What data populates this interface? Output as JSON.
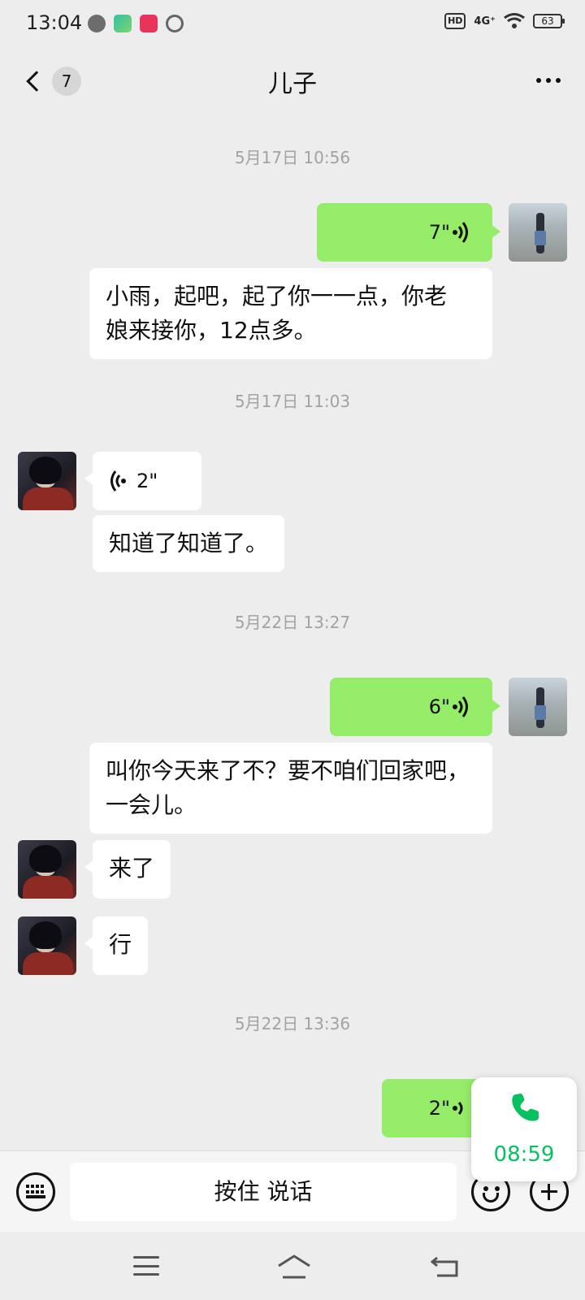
{
  "status_bar": {
    "time": "13:04",
    "network_badge": "HD",
    "signal": "4G⁺",
    "battery": "63"
  },
  "header": {
    "back_icon": "chevron-left-icon",
    "unread_count": "7",
    "title": "儿子",
    "more_icon": "more-dots-icon"
  },
  "messages": [
    {
      "type": "timestamp",
      "text": "5月17日 10:56"
    },
    {
      "type": "voice",
      "from": "me",
      "duration": "7\""
    },
    {
      "type": "transcript",
      "text_line1": "小雨，起吧，起了你一一点，你老",
      "text_line2": "娘来接你，12点多。"
    },
    {
      "type": "timestamp",
      "text": "5月17日 11:03"
    },
    {
      "type": "voice",
      "from": "other",
      "duration": "2\""
    },
    {
      "type": "transcript",
      "text": "知道了知道了。"
    },
    {
      "type": "timestamp",
      "text": "5月22日 13:27"
    },
    {
      "type": "voice",
      "from": "me",
      "duration": "6\""
    },
    {
      "type": "transcript",
      "text_line1": "叫你今天来了不？要不咱们回家吧，",
      "text_line2": "一会儿。"
    },
    {
      "type": "text",
      "from": "other",
      "text": "来了"
    },
    {
      "type": "text",
      "from": "other",
      "text": "行"
    },
    {
      "type": "timestamp",
      "text": "5月22日 13:36"
    },
    {
      "type": "voice",
      "from": "me",
      "duration": "2\""
    }
  ],
  "input_bar": {
    "keyboard_icon": "keyboard-icon",
    "hold_to_talk": "按住 说话",
    "emoji_icon": "emoji-icon",
    "plus_icon": "plus-icon"
  },
  "call_float": {
    "icon": "phone-icon",
    "time": "08:59",
    "color": "#07c160"
  },
  "colors": {
    "background": "#ededed",
    "bubble_me": "#95ec69",
    "bubble_other": "#ffffff",
    "timestamp": "#a2a2a2"
  }
}
